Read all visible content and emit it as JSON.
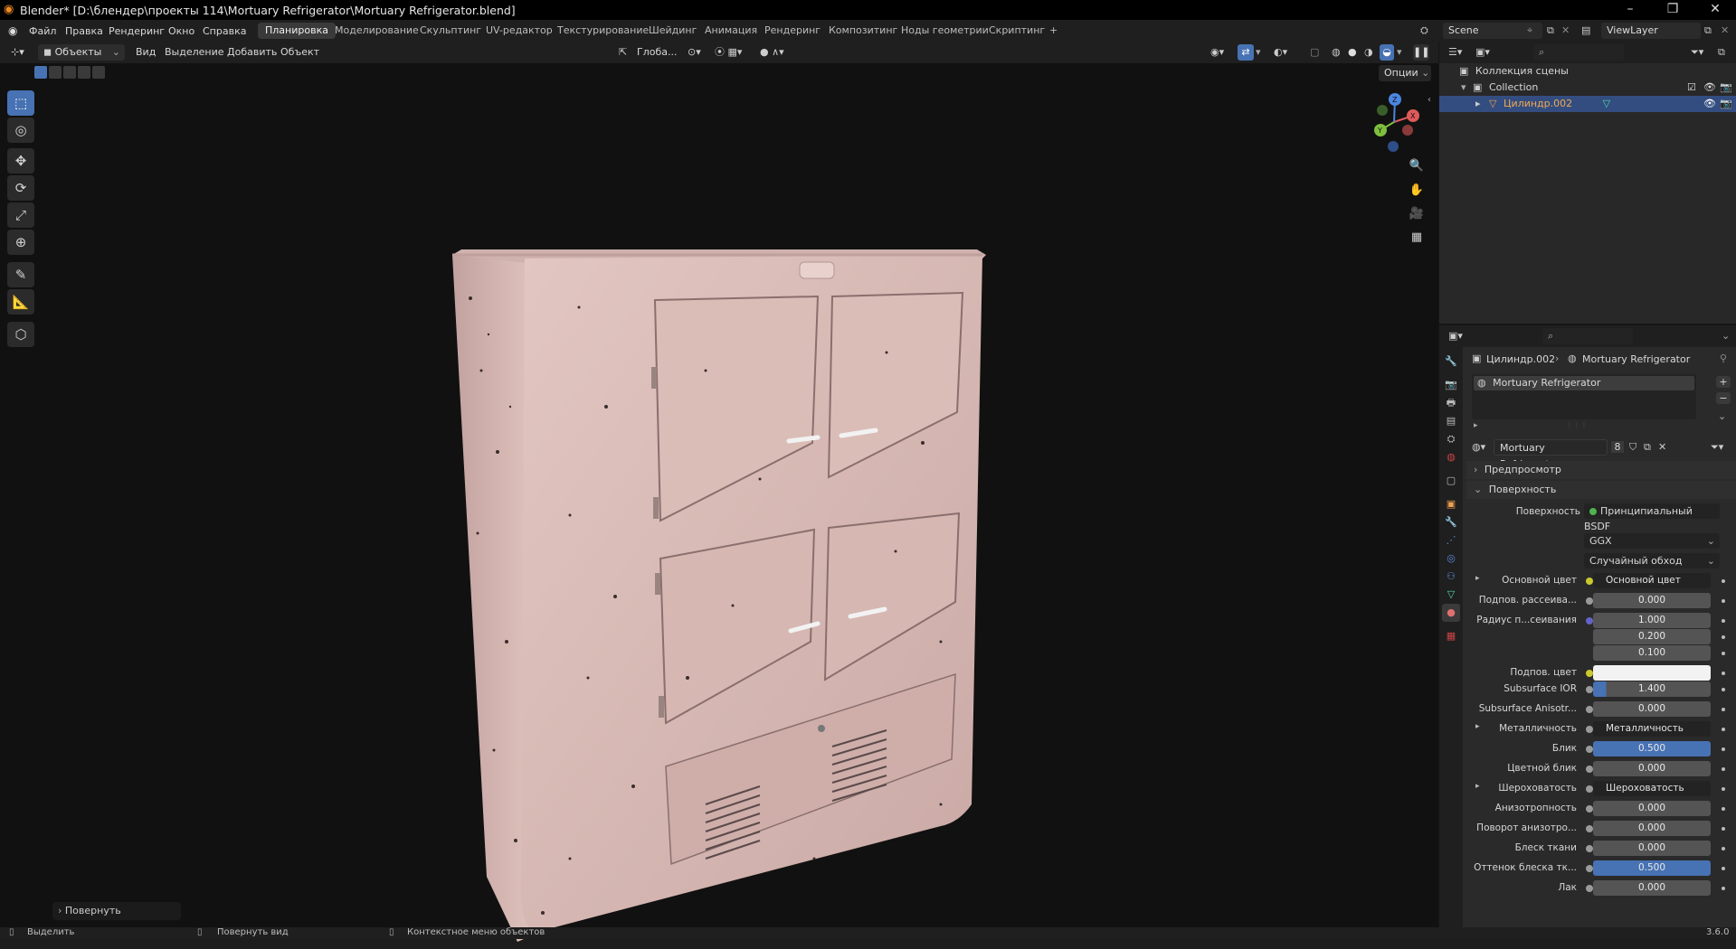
{
  "window": {
    "title": "Blender* [D:\\блендер\\проекты 114\\Mortuary Refrigerator\\Mortuary Refrigerator.blend]",
    "controls": [
      "–",
      "❐",
      "✕"
    ]
  },
  "menubar": {
    "menus": [
      "Файл",
      "Правка",
      "Рендеринг",
      "Окно",
      "Справка"
    ],
    "workspaces": [
      "Планировка",
      "Моделирование",
      "Скульптинг",
      "UV-редактор",
      "Текстурирование",
      "Шейдинг",
      "Анимация",
      "Рендеринг",
      "Композитинг",
      "Ноды геометрии",
      "Скриптинг"
    ],
    "active_workspace": "Планировка",
    "add_tab": "+",
    "scene": "Scene",
    "view_layer": "ViewLayer"
  },
  "viewport_header": {
    "mode": "Объекты",
    "menus": [
      "Вид",
      "Выделение",
      "Добавить",
      "Объект"
    ],
    "transform_orientation": "Глоба...",
    "options": "Опции"
  },
  "viewport": {
    "last_operator": "Повернуть",
    "gizmo_axes": [
      "X",
      "Y",
      "Z"
    ]
  },
  "outliner": {
    "root": "Коллекция сцены",
    "collection": "Collection",
    "object": "Цилиндр.002"
  },
  "properties": {
    "breadcrumb_object": "Цилиндр.002",
    "breadcrumb_material": "Mortuary Refrigerator",
    "slot_name": "Mortuary Refrigerator",
    "material_name": "Mortuary Refrigerator",
    "user_count": "8",
    "panel_preview": "Предпросмотр",
    "panel_surface": "Поверхность",
    "surface_label": "Поверхность",
    "surface_shader": "Принципиальный BSDF",
    "distribution": "GGX",
    "subsurface_method": "Случайный обход",
    "rows": [
      {
        "label": "Основной цвет",
        "kind": "link",
        "value": "Основной цвет",
        "arrow": true,
        "dot": "yellow"
      },
      {
        "label": "Подпов. рассеива...",
        "kind": "num",
        "value": "0.000",
        "dot": "grey"
      },
      {
        "label": "Радиус п...сеивания",
        "kind": "num",
        "value": "1.000",
        "dot": "blue"
      },
      {
        "label": "",
        "kind": "num",
        "value": "0.200",
        "dot": ""
      },
      {
        "label": "",
        "kind": "num",
        "value": "0.100",
        "dot": ""
      },
      {
        "label": "Подпов. цвет",
        "kind": "color",
        "value": "",
        "dot": "yellow"
      },
      {
        "label": "Subsurface IOR",
        "kind": "numsel",
        "value": "1.400",
        "dot": "grey"
      },
      {
        "label": "Subsurface Anisotr...",
        "kind": "num",
        "value": "0.000",
        "dot": "grey"
      },
      {
        "label": "Металличность",
        "kind": "link",
        "value": "Металличность",
        "arrow": true,
        "dot": "grey"
      },
      {
        "label": "Блик",
        "kind": "sel",
        "value": "0.500",
        "dot": "grey"
      },
      {
        "label": "Цветной блик",
        "kind": "num",
        "value": "0.000",
        "dot": "grey"
      },
      {
        "label": "Шероховатость",
        "kind": "link",
        "value": "Шероховатость",
        "arrow": true,
        "dot": "grey"
      },
      {
        "label": "Анизотропность",
        "kind": "num",
        "value": "0.000",
        "dot": "grey"
      },
      {
        "label": "Поворот анизотро...",
        "kind": "num",
        "value": "0.000",
        "dot": "grey"
      },
      {
        "label": "Блеск ткани",
        "kind": "num",
        "value": "0.000",
        "dot": "grey"
      },
      {
        "label": "Оттенок блеска тк...",
        "kind": "sel",
        "value": "0.500",
        "dot": "grey"
      },
      {
        "label": "Лак",
        "kind": "num",
        "value": "0.000",
        "dot": "grey"
      }
    ]
  },
  "statusbar": {
    "items": [
      "Выделить",
      "Повернуть вид",
      "Контекстное меню объектов"
    ],
    "version": "3.6.0"
  },
  "colors": {
    "accent": "#4772b3",
    "selected_object": "#e3a04a",
    "fridge_body": "#d3b2ae"
  }
}
